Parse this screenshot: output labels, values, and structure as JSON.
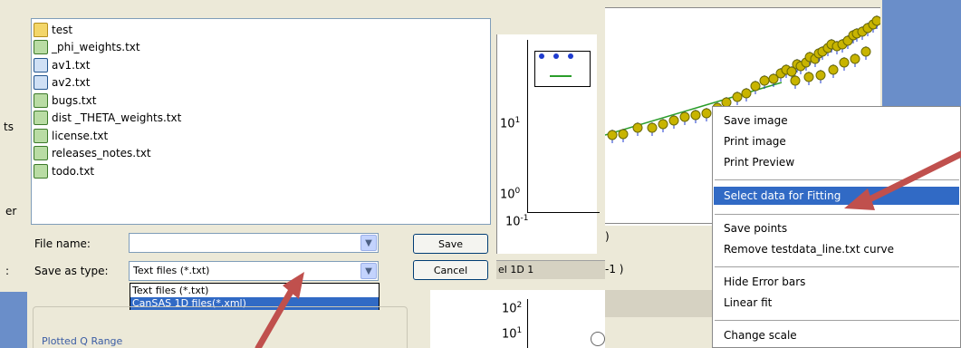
{
  "left_dialog": {
    "files": [
      {
        "name": "test",
        "icon": "folder-icon"
      },
      {
        "name": "_phi_weights.txt",
        "icon": "text-file-icon"
      },
      {
        "name": "av1.txt",
        "icon": "text-file-blue-icon"
      },
      {
        "name": "av2.txt",
        "icon": "text-file-blue-icon"
      },
      {
        "name": "bugs.txt",
        "icon": "text-file-icon"
      },
      {
        "name": "dist _THETA_weights.txt",
        "icon": "text-file-icon"
      },
      {
        "name": "license.txt",
        "icon": "text-file-icon"
      },
      {
        "name": "releases_notes.txt",
        "icon": "text-file-icon"
      },
      {
        "name": "todo.txt",
        "icon": "text-file-icon"
      }
    ],
    "file_name_label": "File name:",
    "file_name_value": "",
    "save_as_type_label": "Save as type:",
    "save_as_type_value": "Text files (*.txt)",
    "save_button": "Save",
    "cancel_button": "Cancel",
    "dropdown_options": [
      "Text files (*.txt)",
      "CanSAS 1D files(*.xml)"
    ],
    "dropdown_selected_index": 1,
    "sidebar_fragments": [
      "ts",
      "er",
      ":"
    ],
    "plotted_q_range_label": "Plotted Q Range",
    "background_tab_label": "el 1D  1"
  },
  "left_plot": {
    "y_ticks": [
      "10",
      "10"
    ],
    "y_tick_exponents": [
      "1",
      "0"
    ],
    "x_tick": "10",
    "x_tick_exponent": "-1",
    "lower_y_ticks": [
      "10",
      "10"
    ],
    "lower_y_tick_exponents": [
      "2",
      "1"
    ]
  },
  "right_context_menu": {
    "items": [
      "Save image",
      "Print image",
      "Print Preview",
      "Select data  for Fitting",
      "Save points",
      "Remove testdata_line.txt curve",
      "Hide Error bars",
      "Linear fit",
      "Change scale"
    ],
    "highlighted_index": 3
  },
  "right_plot_fragments": {
    "x_label_fragment": ")",
    "x_label_fragment2": "-1 )"
  },
  "colors": {
    "xp_dialog_bg": "#ece9d8",
    "selection_blue": "#316ac5",
    "annotation_arrow": "#c0504d",
    "data_point": "#c8b400",
    "fit_line": "#2a9d2a"
  }
}
